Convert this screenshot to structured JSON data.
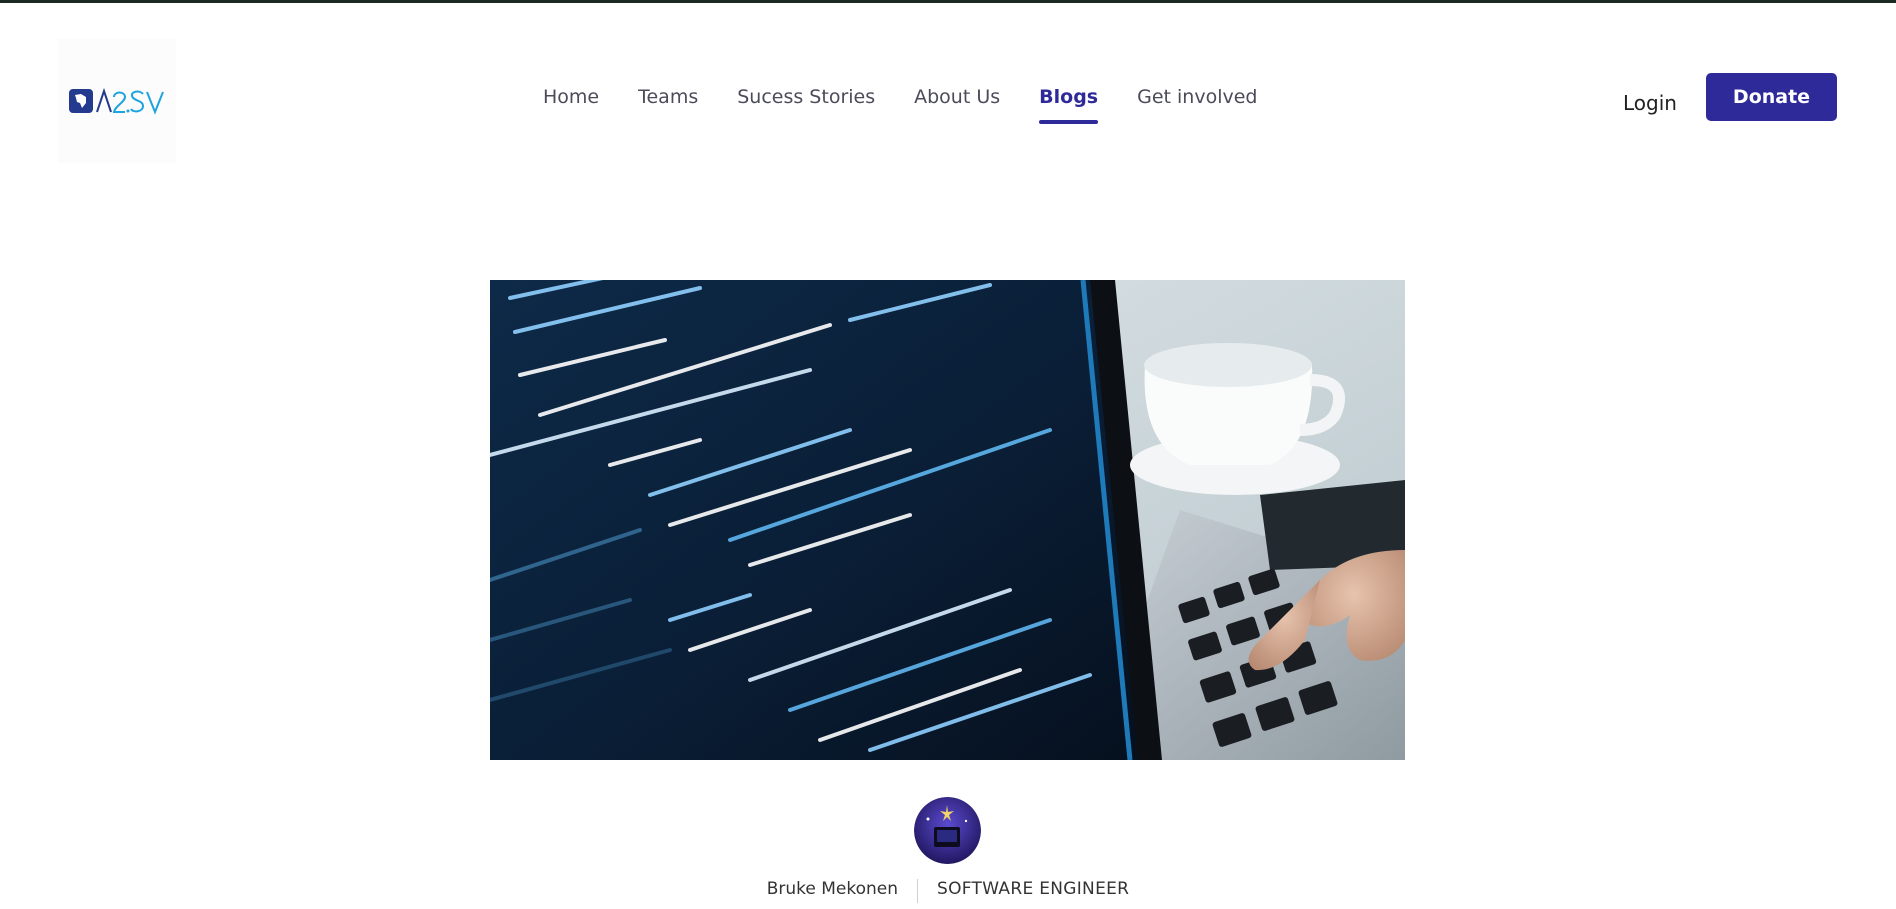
{
  "header": {
    "logo_text": "A2SV",
    "nav": [
      {
        "label": "Home",
        "active": false
      },
      {
        "label": "Teams",
        "active": false
      },
      {
        "label": "Sucess Stories",
        "active": false
      },
      {
        "label": "About Us",
        "active": false
      },
      {
        "label": "Blogs",
        "active": true
      },
      {
        "label": "Get involved",
        "active": false
      }
    ],
    "login_label": "Login",
    "donate_label": "Donate"
  },
  "hero": {
    "image_icon": "laptop-code-photo"
  },
  "author": {
    "name": "Bruke Mekonen",
    "role": "SOFTWARE ENGINEER",
    "avatar_icon": "author-avatar"
  },
  "colors": {
    "brand": "#2f2a9a",
    "logo_accent": "#1ea3dd",
    "logo_dark": "#233a8e",
    "nav_text": "#4b4b5a"
  }
}
